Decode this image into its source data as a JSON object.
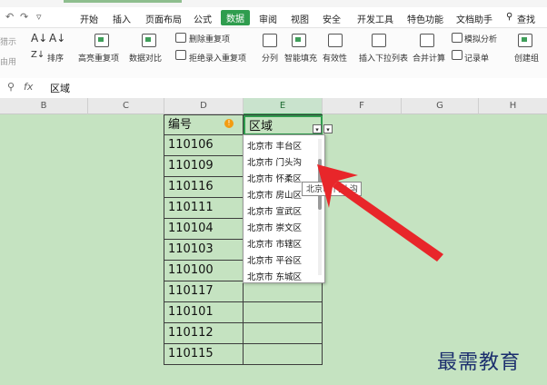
{
  "menubar": {
    "tabs": [
      "开始",
      "插入",
      "页面布局",
      "公式",
      "数据",
      "审阅",
      "视图",
      "安全",
      "开发工具",
      "特色功能",
      "文档助手"
    ],
    "active_tab": "数据",
    "search": "查找"
  },
  "ribbon": {
    "partial_left": [
      "猎示",
      "由用"
    ],
    "sort": "排序",
    "highlight_dup": "高亮重复项",
    "compare": "数据对比",
    "remove_dup": "删除重复项",
    "reject_dup": "拒绝录入重复项",
    "split": "分列",
    "smart_fill": "智能填充",
    "validity": "有效性",
    "insert_dropdown": "插入下拉列表",
    "consolidate": "合并计算",
    "what_if": "模拟分析",
    "record": "记录单",
    "create_group": "创建组"
  },
  "formula_bar": {
    "fx": "fx",
    "content": "区域"
  },
  "columns": [
    "B",
    "C",
    "D",
    "E",
    "F",
    "G",
    "H"
  ],
  "table": {
    "header_code": "编号",
    "header_area": "区域",
    "codes": [
      "110106",
      "110109",
      "110116",
      "110111",
      "110104",
      "110103",
      "110100",
      "110117",
      "110101",
      "110112",
      "110115"
    ]
  },
  "dropdown": {
    "options": [
      "北京市 丰台区",
      "北京市 门头沟",
      "北京市 怀柔区",
      "北京市 房山区",
      "北京市 宣武区",
      "北京市 崇文区",
      "北京市 市辖区",
      "北京市 平谷区",
      "北京市 东城区"
    ]
  },
  "tooltip": "北京市 门头沟",
  "watermark": "最需教育",
  "colors": {
    "accent": "#2f9d4e",
    "sheet_bg": "#c5e3c1",
    "arrow": "#e8262a"
  }
}
